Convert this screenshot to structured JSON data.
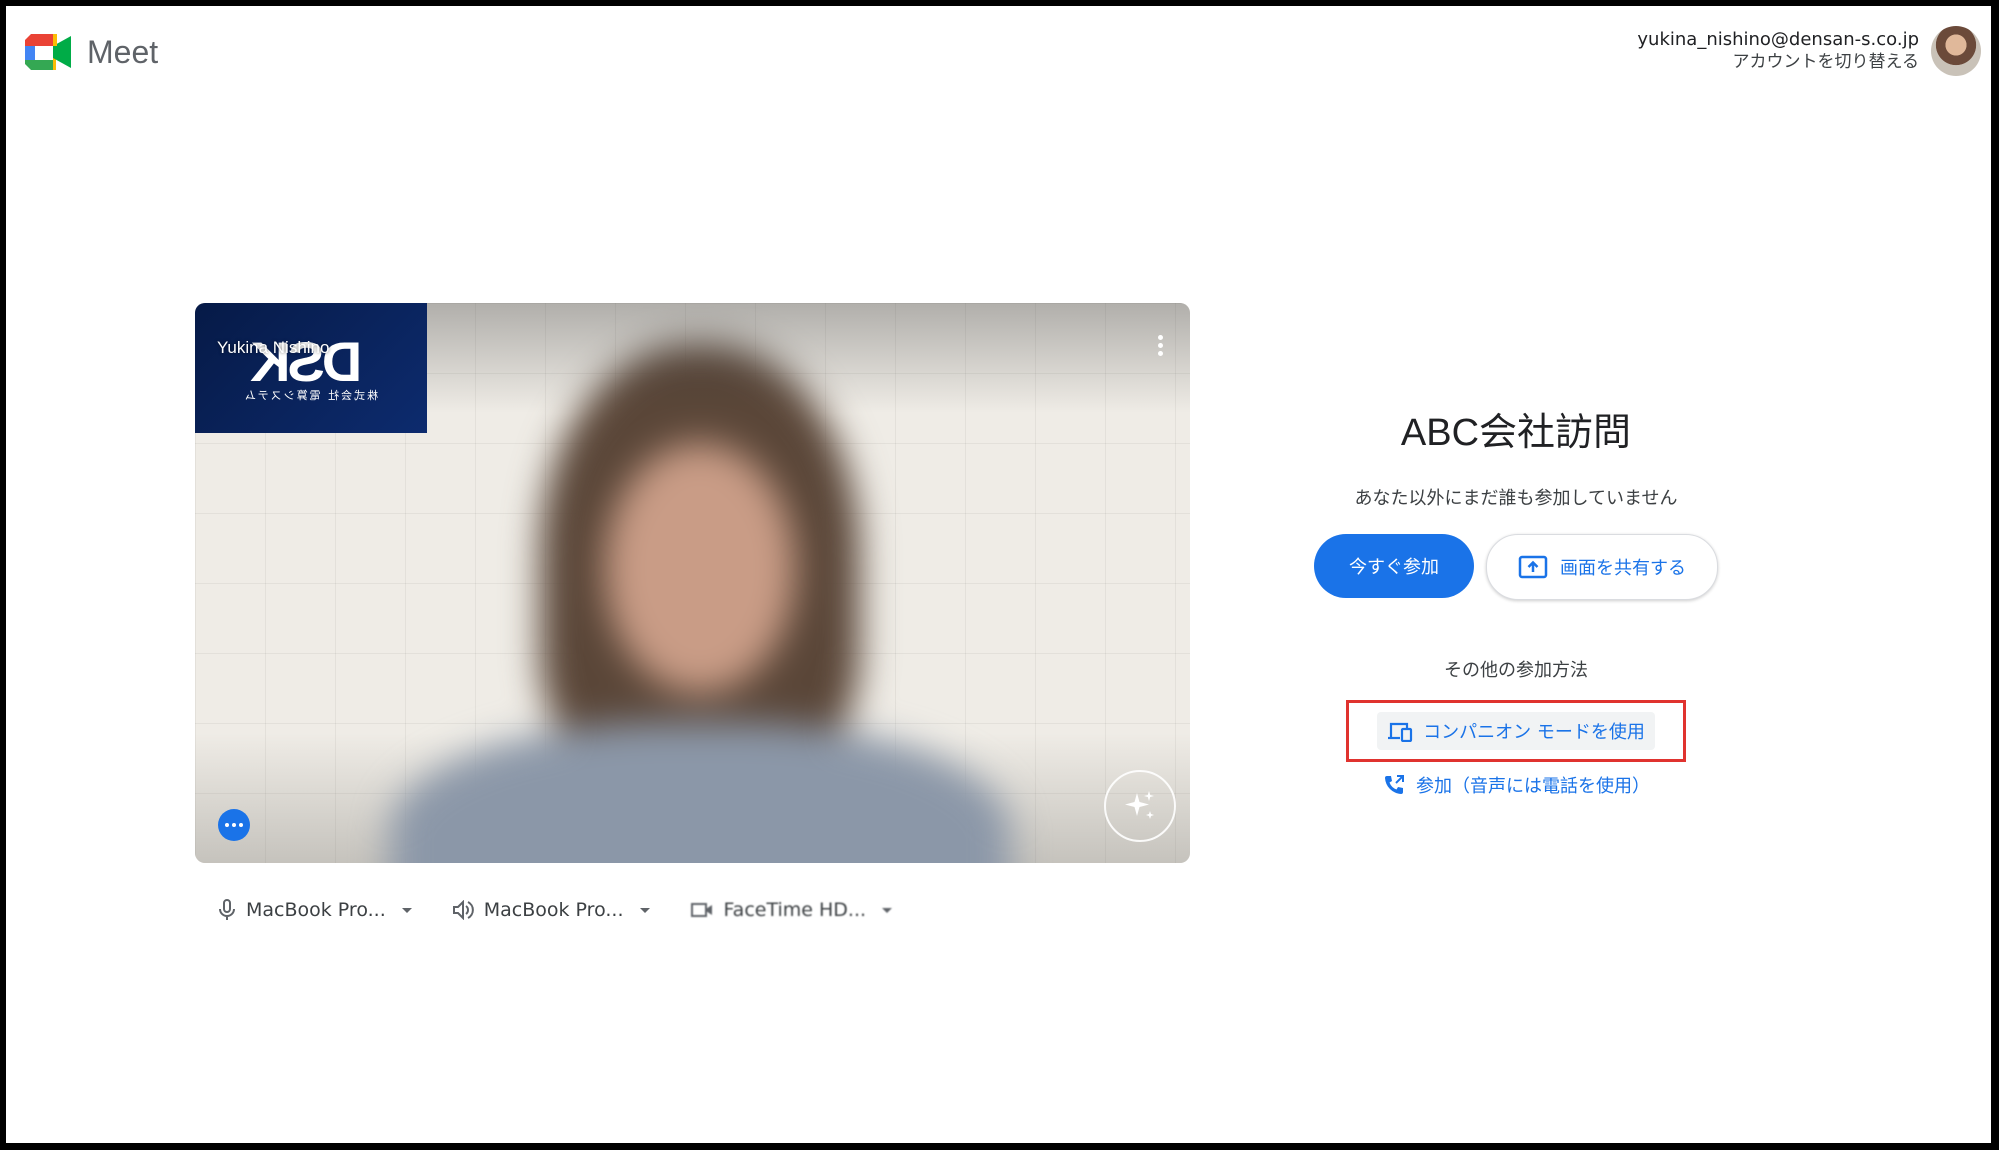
{
  "header": {
    "app_name": "Meet",
    "account_email": "yukina_nishino@densan-s.co.jp",
    "switch_account": "アカウントを切り替える"
  },
  "preview": {
    "self_name": "Yukina Nishino",
    "logo_text": "DSK",
    "logo_subtext": "株式会社 電算システム"
  },
  "devices": {
    "microphone": "MacBook Pro...",
    "speaker": "MacBook Pro...",
    "camera": "FaceTime HD..."
  },
  "meeting": {
    "title": "ABC会社訪問",
    "status": "あなた以外にまだ誰も参加していません",
    "join_now": "今すぐ参加",
    "present": "画面を共有する",
    "other_ways": "その他の参加方法",
    "companion_mode": "コンパニオン モードを使用",
    "join_by_phone": "参加（音声には電話を使用）"
  },
  "colors": {
    "accent": "#1a73e8",
    "highlight_box": "#e0332f"
  },
  "icons": [
    "meet-logo-icon",
    "mic-icon",
    "speaker-icon",
    "camera-icon",
    "more-vert-icon",
    "sparkle-icon",
    "more-horiz-icon",
    "present-icon",
    "companion-icon",
    "phone-icon"
  ]
}
